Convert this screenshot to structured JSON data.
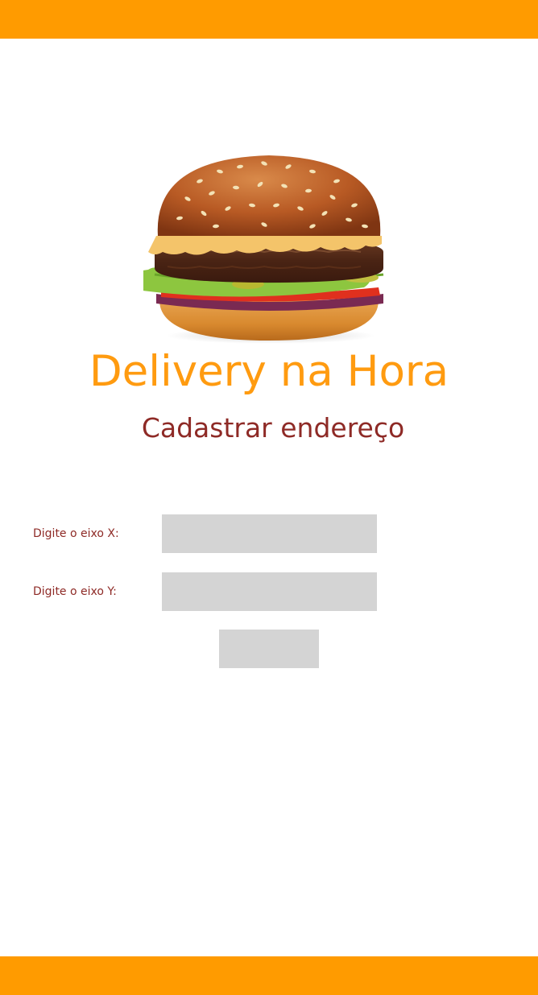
{
  "theme": {
    "bar_color": "#ff9b00",
    "title_color": "#ff9b10",
    "text_color": "#8e2a26",
    "field_color": "#d4d4d4"
  },
  "header": {
    "image": "hamburger-image",
    "title": "Delivery na Hora",
    "subtitle": "Cadastrar endereço"
  },
  "form": {
    "x_field": {
      "label": "Digite o eixo X:",
      "value": "",
      "placeholder": ""
    },
    "y_field": {
      "label": "Digite o eixo Y:",
      "value": "",
      "placeholder": ""
    },
    "submit_label": ""
  }
}
